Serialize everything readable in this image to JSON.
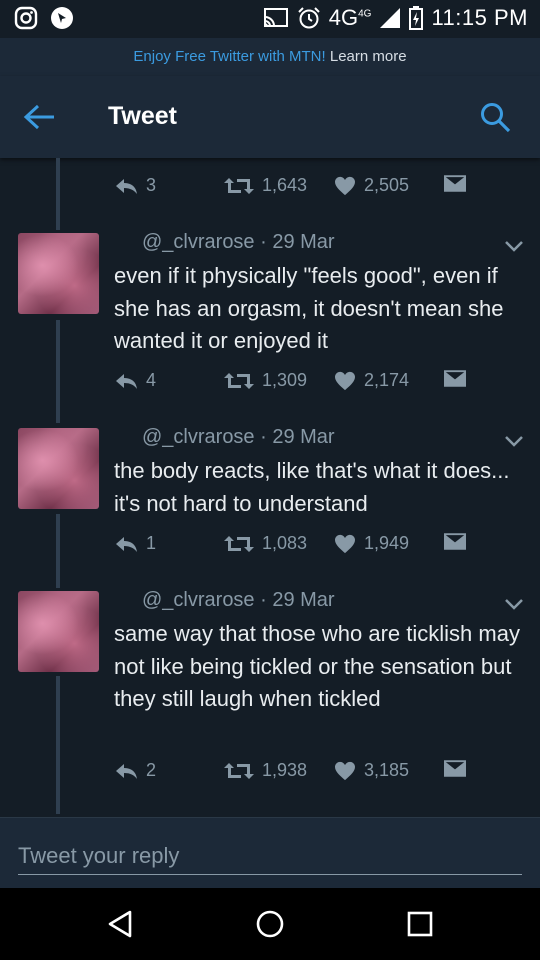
{
  "status_bar": {
    "time": "11:15 PM",
    "network": "4G",
    "network_sup": "4G",
    "left_icons": [
      "instagram-icon",
      "notification-app-icon"
    ],
    "right_icons": [
      "cast-icon",
      "alarm-icon",
      "signal-icon",
      "battery-icon"
    ]
  },
  "promo": {
    "brand_text": "Enjoy Free Twitter with MTN!",
    "link_text": "Learn more"
  },
  "app_bar": {
    "title": "Tweet",
    "back_icon": "arrow-left-icon",
    "search_icon": "search-icon"
  },
  "colors": {
    "accent": "#3b9be0",
    "background": "#141d26",
    "bar": "#1c2938",
    "muted": "#8899a6"
  },
  "top_actions": {
    "replies": "3",
    "retweets": "1,643",
    "likes": "2,505"
  },
  "tweets": [
    {
      "handle": "@_clvrarose · 29 Mar",
      "text": "even if it physically \"feels good\", even if she has an orgasm, it doesn't mean she wanted it or enjoyed it",
      "replies": "4",
      "retweets": "1,309",
      "likes": "2,174"
    },
    {
      "handle": "@_clvrarose · 29 Mar",
      "text": "the body reacts, like that's what it does... it's not hard to understand",
      "replies": "1",
      "retweets": "1,083",
      "likes": "1,949"
    },
    {
      "handle": "@_clvrarose · 29 Mar",
      "text": "same way that those who are ticklish may not like being tickled or the sensation but they still laugh when tickled",
      "replies": "2",
      "retweets": "1,938",
      "likes": "3,185"
    }
  ],
  "reply": {
    "placeholder": "Tweet your reply"
  },
  "nav_bar": {
    "icons": [
      "back-triangle-icon",
      "home-circle-icon",
      "recents-square-icon"
    ]
  }
}
